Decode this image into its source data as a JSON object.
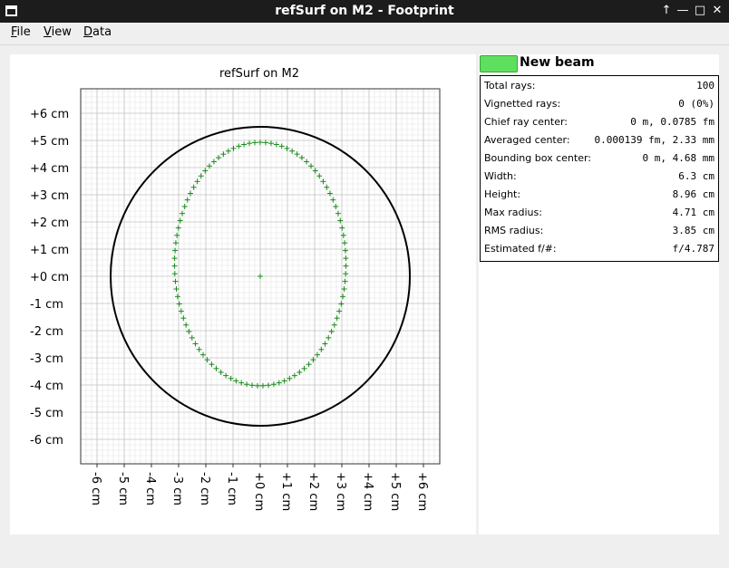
{
  "window": {
    "title": "refSurf on M2 - Footprint",
    "controls": [
      "keep-above-icon",
      "minimize-icon",
      "maximize-icon",
      "close-icon"
    ]
  },
  "menu": {
    "items": [
      {
        "label": "File",
        "underline": "F",
        "rest": "ile"
      },
      {
        "label": "View",
        "underline": "V",
        "rest": "iew"
      },
      {
        "label": "Data",
        "underline": "D",
        "rest": "ata"
      }
    ]
  },
  "plot": {
    "title": "refSurf on M2",
    "unit": "cm",
    "xticks": [
      "-6 cm",
      "-5 cm",
      "-4 cm",
      "-3 cm",
      "-2 cm",
      "-1 cm",
      "+0 cm",
      "+1 cm",
      "+2 cm",
      "+3 cm",
      "+4 cm",
      "+5 cm",
      "+6 cm"
    ],
    "yticks": [
      "+6  cm",
      "+5  cm",
      "+4  cm",
      "+3  cm",
      "+2  cm",
      "+1  cm",
      "+0  cm",
      "-1  cm",
      "-2  cm",
      "-3  cm",
      "-4  cm",
      "-5  cm",
      "-6  cm"
    ]
  },
  "chart_data": {
    "type": "scatter",
    "title": "refSurf on M2",
    "xlim": [
      -6.6,
      6.6
    ],
    "ylim": [
      -6.9,
      6.9
    ],
    "grid": true,
    "aperture": {
      "shape": "circle",
      "center": [
        0,
        0
      ],
      "radius": 5.5,
      "color": "#000000"
    },
    "series": [
      {
        "marker": "+",
        "color": "#1a8a1a",
        "points": "ellipse of 100 rays around centre plus chief ray at origin",
        "ellipse": {
          "cx": 0.0,
          "cy": 0.45,
          "rx": 3.15,
          "ry": 4.48,
          "count": 99
        },
        "chief_ray": [
          0,
          0
        ]
      }
    ]
  },
  "beam": {
    "name": "New beam",
    "color": "#5ee05e"
  },
  "stats": [
    {
      "label": "Total rays:",
      "value": "100"
    },
    {
      "label": "Vignetted rays:",
      "value": "0 (0%)"
    },
    {
      "label": "Chief ray center:",
      "value": "0 m, 0.0785 fm"
    },
    {
      "label": "Averaged center:",
      "value": "0.000139 fm, 2.33 mm"
    },
    {
      "label": "Bounding box center:",
      "value": "0 m, 4.68 mm"
    },
    {
      "label": "Width:",
      "value": "6.3 cm"
    },
    {
      "label": "Height:",
      "value": "8.96 cm"
    },
    {
      "label": "Max radius:",
      "value": "4.71 cm"
    },
    {
      "label": "RMS radius:",
      "value": "3.85 cm"
    },
    {
      "label": "Estimated f/#:",
      "value": "f/4.787"
    }
  ]
}
